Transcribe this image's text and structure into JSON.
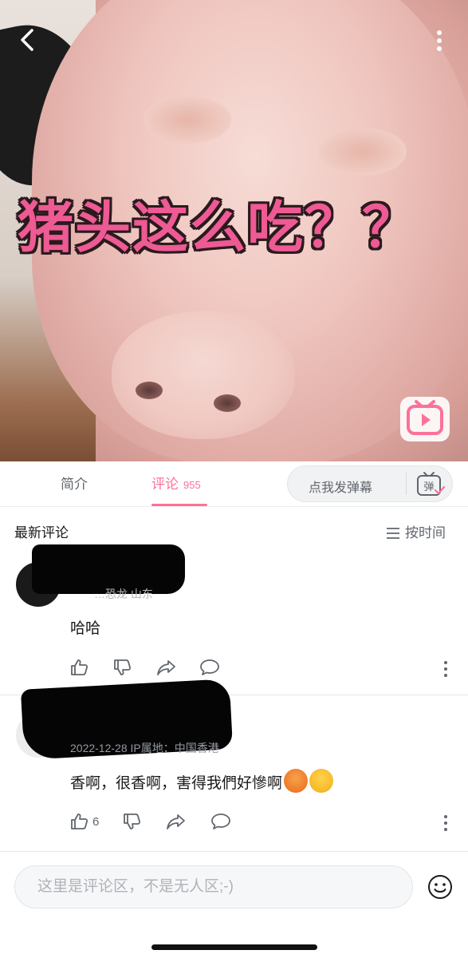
{
  "video": {
    "overlay_title": "猪头这么吃？？",
    "back_icon": "chevron-left-icon",
    "more_icon": "vertical-dots-icon",
    "play_icon": "play-badge-icon"
  },
  "tabs": [
    {
      "label": "简介",
      "count": ""
    },
    {
      "label": "评论",
      "count": "955"
    }
  ],
  "danmaku": {
    "placeholder": "点我发弹幕",
    "icon_label": "弹"
  },
  "comments_section": {
    "title": "最新评论",
    "sort_label": "按时间"
  },
  "comments": [
    {
      "meta_visible": "…恐龙  山东",
      "text": "哈哈",
      "like_count": "",
      "emojis": []
    },
    {
      "meta_visible": "2022-12-28  IP属地：中国香港",
      "text": "香啊，很香啊，害得我們好慘啊",
      "like_count": "6",
      "emojis": [
        "crying-face-emoji",
        "laughing-crying-emoji"
      ]
    }
  ],
  "input": {
    "placeholder": "这里是评论区，不是无人区;-)"
  },
  "colors": {
    "accent": "#fb7299",
    "text_primary": "#18191c",
    "text_secondary": "#61666d",
    "text_meta": "#9499a0"
  }
}
